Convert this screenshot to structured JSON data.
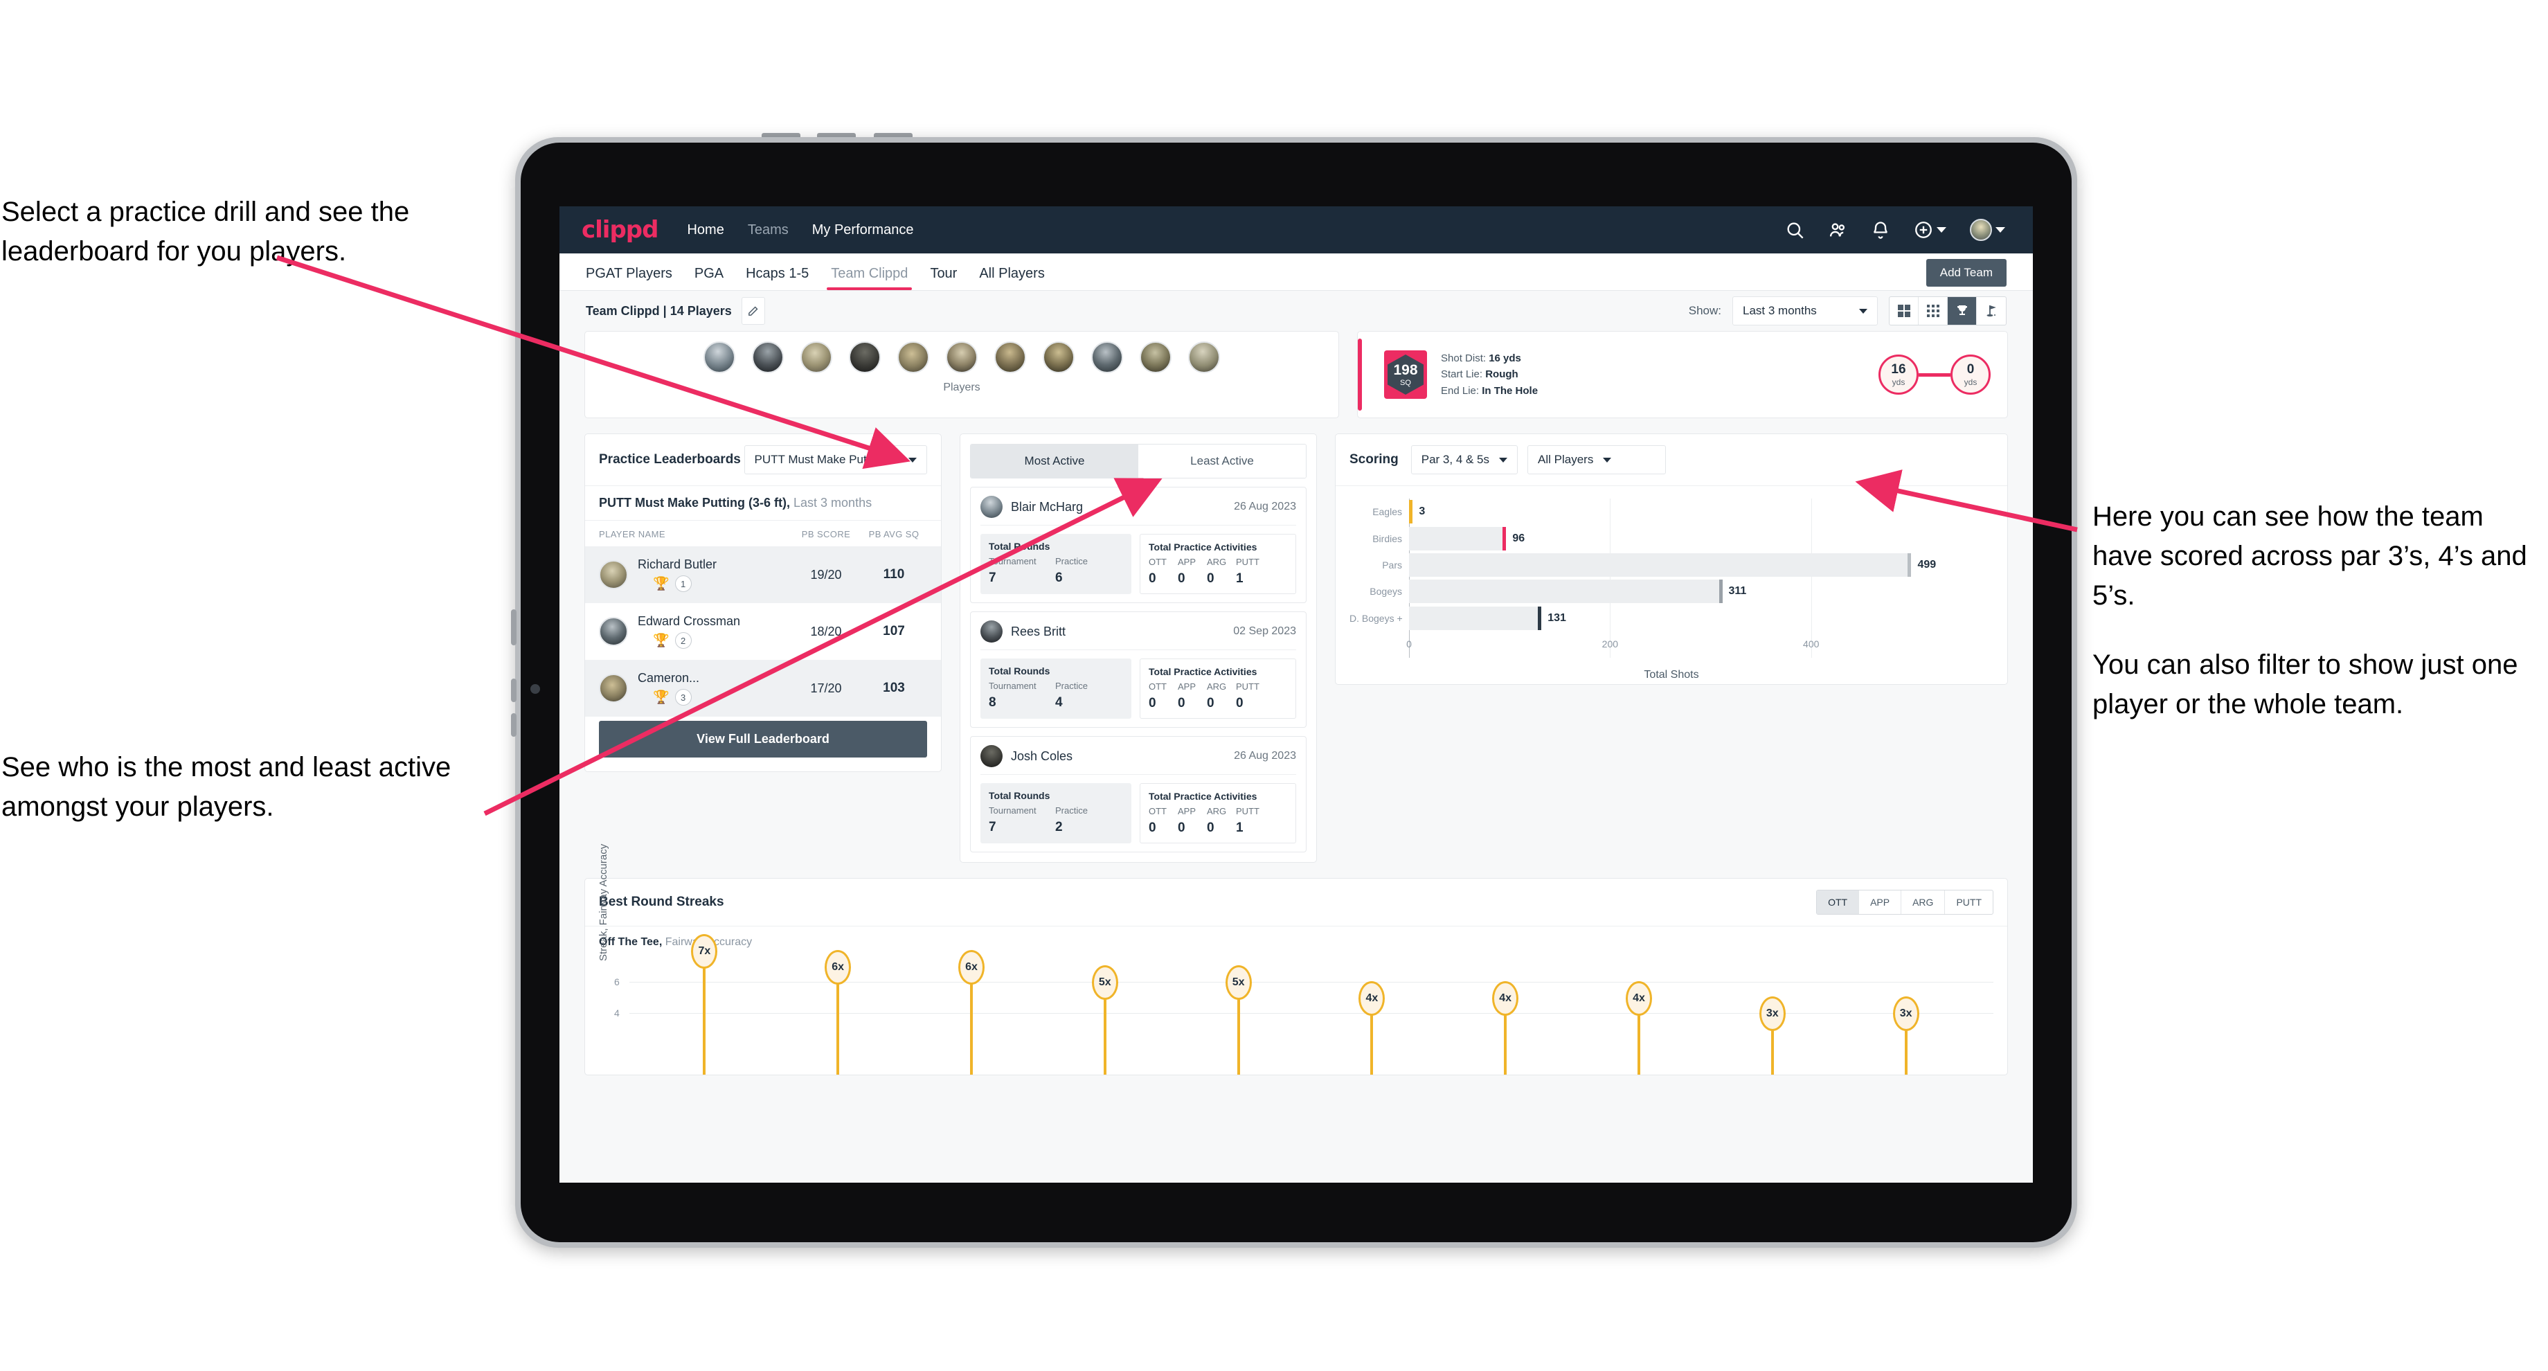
{
  "annotations": {
    "top_left": "Select a practice drill and see the leaderboard for you players.",
    "bottom_left": "See who is the most and least active amongst your players.",
    "right_1": "Here you can see how the team have scored across par 3’s, 4’s and 5’s.",
    "right_2": "You can also filter to show just one player or the whole team."
  },
  "colors": {
    "accent": "#ec2c62",
    "navbar": "#1c2b3a",
    "button": "#4b5a67",
    "gold": "#f0b429"
  },
  "topnav": {
    "logo": "clippd",
    "links": [
      {
        "label": "Home",
        "active": true
      },
      {
        "label": "Teams",
        "active": false
      },
      {
        "label": "My Performance",
        "active": true
      }
    ],
    "icons": [
      "search-icon",
      "people-icon",
      "bell-icon",
      "plus-circle-icon",
      "avatar"
    ]
  },
  "tabs": {
    "items": [
      "PGAT Players",
      "PGA",
      "Hcaps 1-5",
      "Team Clippd",
      "Tour",
      "All Players"
    ],
    "active": "Team Clippd",
    "add_team_label": "Add Team"
  },
  "teambar": {
    "label": "Team Clippd | 14 Players",
    "edit_icon": "pencil-icon",
    "show_label": "Show:",
    "show_value": "Last 3 months",
    "view_toggles": [
      "grid-large-icon",
      "grid-small-icon",
      "trophy-icon",
      "flag-icon"
    ],
    "view_active_index": 2
  },
  "players_strip": {
    "label": "Players",
    "count": 11
  },
  "shot_card": {
    "sq_value": "198",
    "sq_unit": "SQ",
    "shot_dist_label": "Shot Dist:",
    "shot_dist_value": "16 yds",
    "start_lie_label": "Start Lie:",
    "start_lie_value": "Rough",
    "end_lie_label": "End Lie:",
    "end_lie_value": "In The Hole",
    "from_value": "16",
    "from_unit": "yds",
    "to_value": "0",
    "to_unit": "yds"
  },
  "leaderboard": {
    "title": "Practice Leaderboards",
    "drill_select": "PUTT Must Make Putting ...",
    "subtitle_bold": "PUTT Must Make Putting (3-6 ft),",
    "subtitle_light": "Last 3 months",
    "columns": [
      "PLAYER NAME",
      "PB SCORE",
      "PB AVG SQ"
    ],
    "rows": [
      {
        "name": "Richard Butler",
        "rank": "1",
        "trophy": "gold",
        "pb_score": "19/20",
        "pb_avg_sq": "110"
      },
      {
        "name": "Edward Crossman",
        "rank": "2",
        "trophy": "silver",
        "pb_score": "18/20",
        "pb_avg_sq": "107"
      },
      {
        "name": "Cameron...",
        "rank": "3",
        "trophy": "bronze",
        "pb_score": "17/20",
        "pb_avg_sq": "103"
      }
    ],
    "button_label": "View Full Leaderboard"
  },
  "activity": {
    "tabs": [
      "Most Active",
      "Least Active"
    ],
    "active_tab": "Most Active",
    "rounds_title": "Total Rounds",
    "rounds_keys": [
      "Tournament",
      "Practice"
    ],
    "practice_title": "Total Practice Activities",
    "practice_keys": [
      "OTT",
      "APP",
      "ARG",
      "PUTT"
    ],
    "items": [
      {
        "name": "Blair McHarg",
        "date": "26 Aug 2023",
        "tournament": "7",
        "practice": "6",
        "ott": "0",
        "app": "0",
        "arg": "0",
        "putt": "1"
      },
      {
        "name": "Rees Britt",
        "date": "02 Sep 2023",
        "tournament": "8",
        "practice": "4",
        "ott": "0",
        "app": "0",
        "arg": "0",
        "putt": "0"
      },
      {
        "name": "Josh Coles",
        "date": "26 Aug 2023",
        "tournament": "7",
        "practice": "2",
        "ott": "0",
        "app": "0",
        "arg": "0",
        "putt": "1"
      }
    ]
  },
  "scoring": {
    "title": "Scoring",
    "par_select": "Par 3, 4 & 5s",
    "player_select": "All Players"
  },
  "streaks": {
    "title": "Best Round Streaks",
    "segments": [
      "OTT",
      "APP",
      "ARG",
      "PUTT"
    ],
    "active_segment": "OTT",
    "sub_bold": "Off The Tee,",
    "sub_light": "Fairway Accuracy"
  },
  "chart_data": [
    {
      "type": "bar",
      "orientation": "horizontal",
      "title": "Scoring",
      "categories": [
        "Eagles",
        "Birdies",
        "Pars",
        "Bogeys",
        "D. Bogeys +"
      ],
      "values": [
        3,
        96,
        499,
        311,
        131
      ],
      "cap_colors": [
        "#f0b429",
        "#ec2c62",
        "#b9bec3",
        "#9aa1a8",
        "#2d3a46"
      ],
      "xlabel": "Total Shots",
      "ylabel": "",
      "xticks": [
        0,
        200,
        400
      ],
      "xlim": [
        0,
        540
      ],
      "grid": true,
      "legend": "none"
    },
    {
      "type": "bar",
      "orientation": "vertical",
      "title": "Best Round Streaks — Off The Tee, Fairway Accuracy",
      "ylabel": "Streak, Fairway Accuracy",
      "yticks": [
        4,
        6
      ],
      "ylim": [
        0,
        7.6
      ],
      "grid": true,
      "legend": "none",
      "values": [
        7,
        6,
        6,
        5,
        5,
        4,
        4,
        4,
        3,
        3
      ],
      "labels": [
        "7x",
        "6x",
        "6x",
        "5x",
        "5x",
        "4x",
        "4x",
        "4x",
        "3x",
        "3x"
      ],
      "categories": [
        "",
        "",
        "",
        "",
        "",
        "",
        "",
        "",
        "",
        ""
      ]
    }
  ]
}
